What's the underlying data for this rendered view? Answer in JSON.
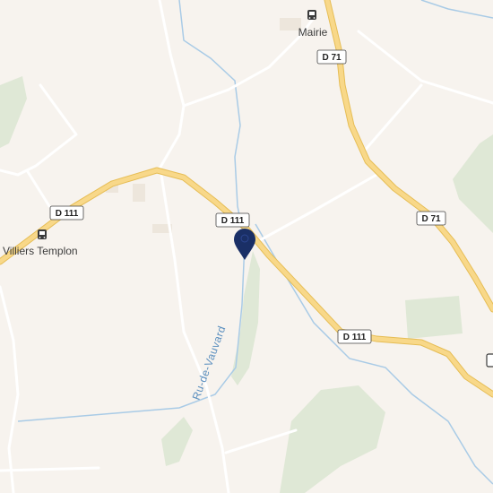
{
  "places": {
    "mairie": "Mairie",
    "villiers": "Villiers Templon"
  },
  "road_shields": {
    "d111_west": "D 111",
    "d111_center": "D 111",
    "d111_east": "D 111",
    "d71_north": "D 71",
    "d71_east": "D 71"
  },
  "waterways": {
    "stream": "Ru-de-Vauvard"
  },
  "icons": {
    "bus_stop": "bus-stop-icon",
    "marker": "location-pin-icon"
  },
  "colors": {
    "background": "#f7f3ee",
    "main_road": "#f5d37a",
    "minor_road": "#ffffff",
    "water": "#a9cbe6",
    "vegetation": "#dfe8d6",
    "marker": "#1a2f66"
  }
}
